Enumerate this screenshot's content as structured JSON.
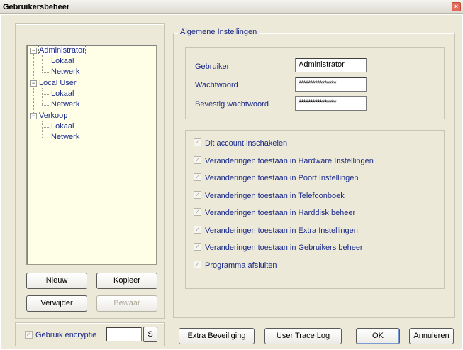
{
  "window": {
    "title": "Gebruikersbeheer",
    "close_glyph": "×"
  },
  "tree": [
    {
      "label": "Administrator",
      "children": [
        "Lokaal",
        "Netwerk"
      ]
    },
    {
      "label": "Local User",
      "children": [
        "Lokaal",
        "Netwerk"
      ]
    },
    {
      "label": "Verkoop",
      "children": [
        "Lokaal",
        "Netwerk"
      ]
    }
  ],
  "tree_expander_glyph": "−",
  "left_buttons": {
    "new": "Nieuw",
    "copy": "Kopieer",
    "delete": "Verwijder",
    "save": "Bewaar"
  },
  "settings": {
    "legend": "Algemene Instellingen",
    "user_label": "Gebruiker",
    "user_value": "Administrator",
    "password_label": "Wachtwoord",
    "password_value": "****************",
    "confirm_label": "Bevestig wachtwoord",
    "confirm_value": "****************"
  },
  "permissions": [
    "Dit account inschakelen",
    "Veranderingen toestaan in Hardware Instellingen",
    "Veranderingen toestaan in Poort Instellingen",
    "Veranderingen toestaan in Telefoonboek",
    "Veranderingen toestaan in Harddisk beheer",
    "Veranderingen toestaan in Extra Instellingen",
    "Veranderingen toestaan in Gebruikers beheer",
    "Programma afsluiten"
  ],
  "check_glyph": "✓",
  "encryption": {
    "label": "Gebruik encryptie",
    "value": "",
    "button": "S"
  },
  "bottom_buttons": {
    "extra_security": "Extra Beveiliging",
    "trace_log": "User Trace Log",
    "ok": "OK",
    "cancel": "Annuleren"
  },
  "colors": {
    "label_blue": "#1a2a8a",
    "tree_bg": "#ffffe8",
    "dialog_bg": "#ece9d8"
  }
}
